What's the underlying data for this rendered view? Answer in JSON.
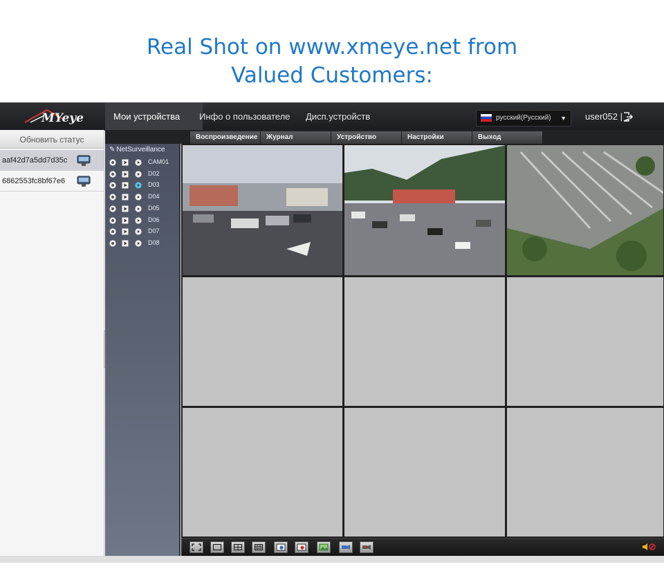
{
  "headline": {
    "line1": "Real Shot on www.xmeye.net from",
    "line2": "Valued Customers:"
  },
  "brand": {
    "logo_text": "MYeye"
  },
  "nav": {
    "tabs": [
      "Мои устройства",
      "Инфо о пользователе",
      "Дисп.устройств"
    ],
    "active": 0
  },
  "language": {
    "selected": "русский(Русский)"
  },
  "user": {
    "name": "user052",
    "separator": "|"
  },
  "subnav": [
    "Воспроизведение",
    "Журнал",
    "Устройство",
    "Настройки",
    "Выход"
  ],
  "sidebar": {
    "refresh_label": "Обновить статус",
    "devices": [
      "aaf42d7a5dd7d35c",
      "6862553fc8bf67e6"
    ]
  },
  "tree": {
    "root": "NetSurveillance",
    "channels": [
      "CAM01",
      "D02",
      "D03",
      "D04",
      "D05",
      "D06",
      "D07",
      "D08"
    ]
  },
  "grid": {
    "rows": 3,
    "cols": 3,
    "live_cells": 3
  },
  "colors": {
    "accent": "#1f78c8",
    "topbar": "#1b1c1f",
    "tree": "#5a6272",
    "empty_cell": "#c3c3c3"
  },
  "icons": [
    "logo-roof-icon",
    "flag-icon",
    "chevron-down-icon",
    "logout-icon",
    "device-icon",
    "record-icon",
    "play-icon",
    "stream-icon",
    "fullscreen-icon",
    "single-view-icon",
    "quad-view-icon",
    "nine-view-icon",
    "snapshot-icon",
    "record-toggle-icon",
    "image-icon",
    "talk-icon",
    "playback-icon",
    "volume-mute-icon"
  ]
}
